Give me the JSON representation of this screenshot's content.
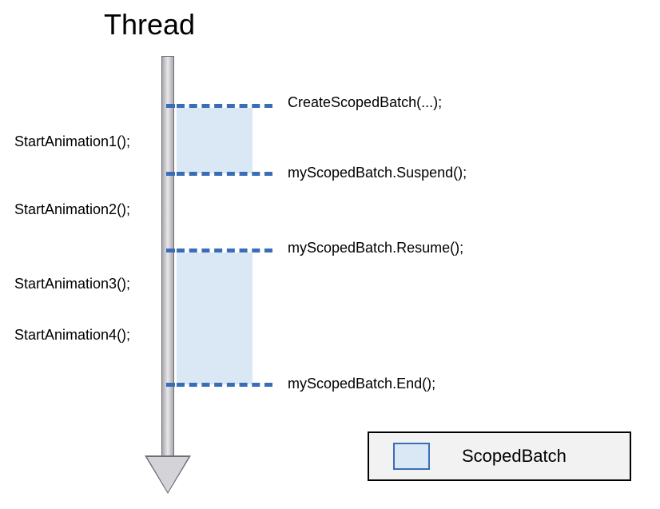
{
  "title": "Thread",
  "left_labels": {
    "l1": "StartAnimation1();",
    "l2": "StartAnimation2();",
    "l3": "StartAnimation3();",
    "l4": "StartAnimation4();"
  },
  "right_labels": {
    "r1": "CreateScopedBatch(...);",
    "r2": "myScopedBatch.Suspend();",
    "r3": "myScopedBatch.Resume();",
    "r4": "myScopedBatch.End();"
  },
  "legend": {
    "label": "ScopedBatch"
  },
  "chart_data": {
    "type": "diagram",
    "title": "Thread",
    "timeline_axis": "vertical (time flows downward)",
    "thread_events_left": [
      "StartAnimation1();",
      "StartAnimation2();",
      "StartAnimation3();",
      "StartAnimation4();"
    ],
    "batch_events_right": [
      {
        "label": "CreateScopedBatch(...);",
        "action": "begin batch region 1"
      },
      {
        "label": "myScopedBatch.Suspend();",
        "action": "end batch region 1"
      },
      {
        "label": "myScopedBatch.Resume();",
        "action": "begin batch region 2"
      },
      {
        "label": "myScopedBatch.End();",
        "action": "end batch region 2"
      }
    ],
    "batch_regions": [
      {
        "start": "CreateScopedBatch(...);",
        "end": "myScopedBatch.Suspend();",
        "contains": [
          "StartAnimation1();"
        ]
      },
      {
        "start": "myScopedBatch.Resume();",
        "end": "myScopedBatch.End();",
        "contains": [
          "StartAnimation3();",
          "StartAnimation4();"
        ]
      }
    ],
    "outside_batch": [
      "StartAnimation2();"
    ],
    "legend": [
      {
        "swatch": "light-blue box",
        "label": "ScopedBatch"
      }
    ]
  }
}
